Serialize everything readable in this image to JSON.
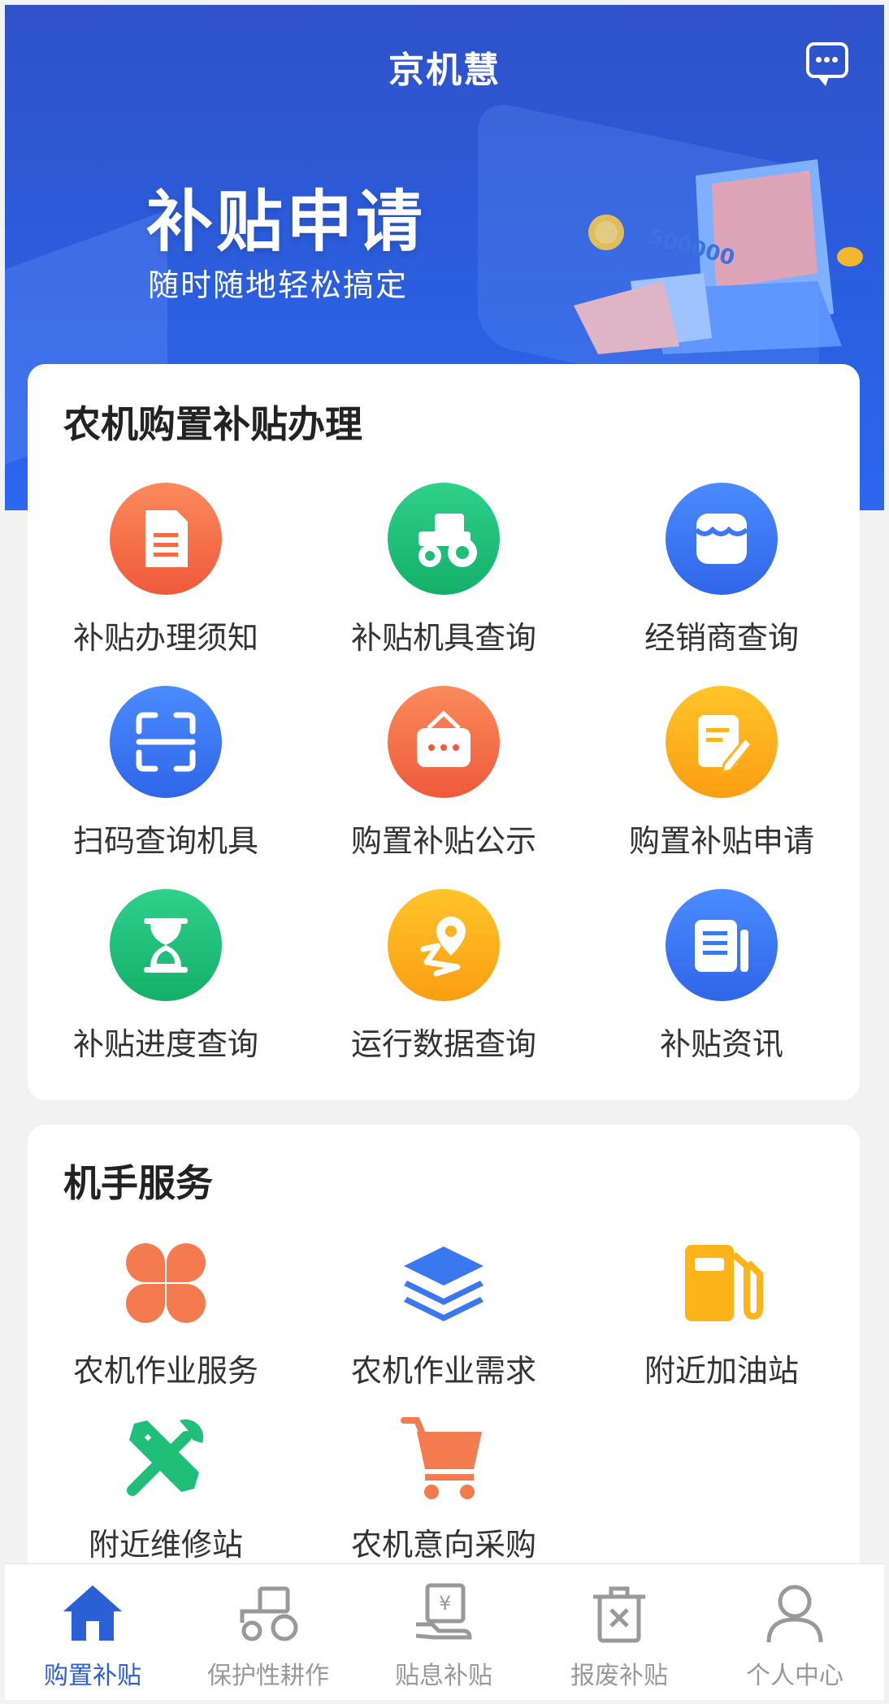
{
  "header": {
    "title": "京机慧",
    "message_icon": "chat-bubble-icon"
  },
  "banner": {
    "title": "补贴申请",
    "subtitle": "随时随地轻松搞定",
    "machine_figure": "500000"
  },
  "purchase_section": {
    "title": "农机购置补贴办理",
    "items": [
      {
        "label": "补贴办理须知",
        "icon": "document-icon",
        "color": "#f26b45"
      },
      {
        "label": "补贴机具查询",
        "icon": "tractor-icon",
        "color": "#1fbf7a"
      },
      {
        "label": "经销商查询",
        "icon": "store-icon",
        "color": "#3a78f0"
      },
      {
        "label": "扫码查询机具",
        "icon": "scan-icon",
        "color": "#3a78f0"
      },
      {
        "label": "购置补贴公示",
        "icon": "notice-board-icon",
        "color": "#f26b45"
      },
      {
        "label": "购置补贴申请",
        "icon": "edit-form-icon",
        "color": "#fdb31a"
      },
      {
        "label": "补贴进度查询",
        "icon": "hourglass-icon",
        "color": "#1fbf7a"
      },
      {
        "label": "运行数据查询",
        "icon": "location-route-icon",
        "color": "#fdb31a"
      },
      {
        "label": "补贴资讯",
        "icon": "news-icon",
        "color": "#3a78f0"
      }
    ]
  },
  "operator_section": {
    "title": "机手服务",
    "items": [
      {
        "label": "农机作业服务",
        "icon": "grid-petals-icon",
        "color": "#f47a50"
      },
      {
        "label": "农机作业需求",
        "icon": "layers-icon",
        "color": "#3a78f0"
      },
      {
        "label": "附近加油站",
        "icon": "fuel-pump-icon",
        "color": "#fdb31a"
      },
      {
        "label": "附近维修站",
        "icon": "wrench-screwdriver-icon",
        "color": "#1fbf7a"
      },
      {
        "label": "农机意向采购",
        "icon": "shopping-cart-icon",
        "color": "#f47a50"
      }
    ]
  },
  "tabbar": {
    "tabs": [
      {
        "label": "购置补贴",
        "icon": "home-icon",
        "active": true
      },
      {
        "label": "保护性耕作",
        "icon": "tractor-outline-icon",
        "active": false
      },
      {
        "label": "贴息补贴",
        "icon": "yen-hand-icon",
        "active": false
      },
      {
        "label": "报废补贴",
        "icon": "trash-icon",
        "active": false
      },
      {
        "label": "个人中心",
        "icon": "user-icon",
        "active": false
      }
    ]
  },
  "colors": {
    "primary": "#2b5fd6",
    "tab_inactive": "#999999"
  }
}
